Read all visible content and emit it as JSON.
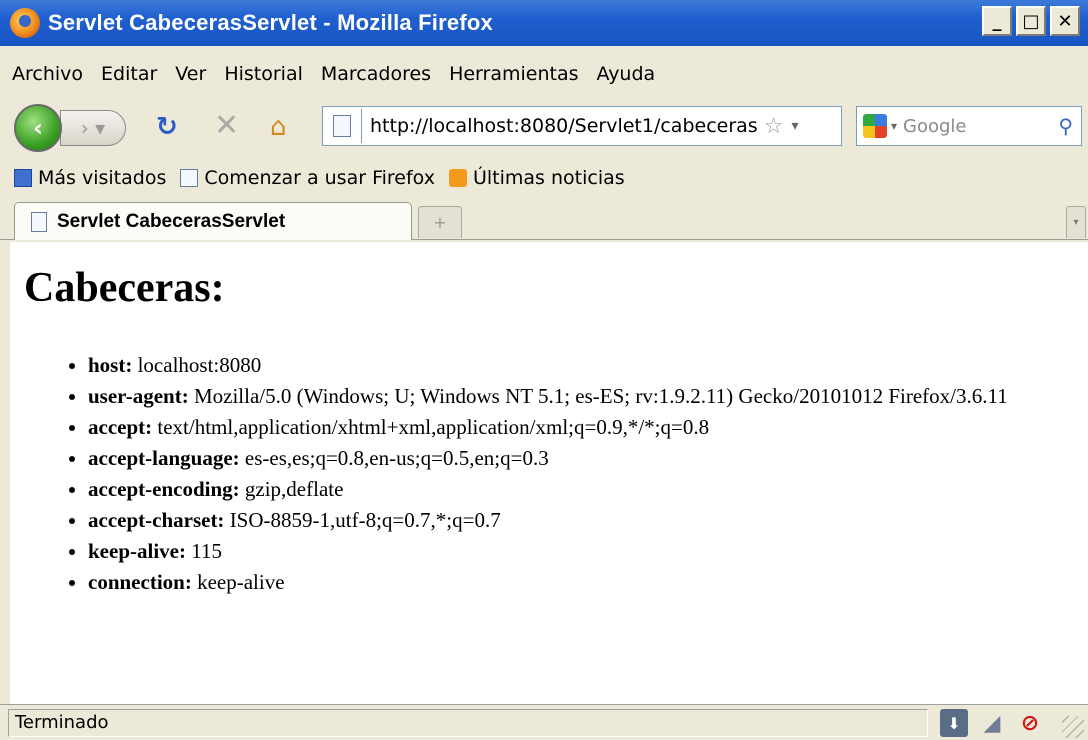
{
  "window": {
    "title": "Servlet CabecerasServlet - Mozilla Firefox",
    "minimize": "_",
    "maximize": "□",
    "close": "✕"
  },
  "menu": [
    "Archivo",
    "Editar",
    "Ver",
    "Historial",
    "Marcadores",
    "Herramientas",
    "Ayuda"
  ],
  "nav": {
    "url": "http://localhost:8080/Servlet1/cabeceras",
    "search_placeholder": "Google"
  },
  "bookmarks": [
    "Más visitados",
    "Comenzar a usar Firefox",
    "Últimas noticias"
  ],
  "tab": {
    "label": "Servlet CabecerasServlet"
  },
  "page": {
    "heading": "Cabeceras:",
    "headers": [
      {
        "name": "host:",
        "value": " localhost:8080"
      },
      {
        "name": "user-agent:",
        "value": " Mozilla/5.0 (Windows; U; Windows NT 5.1; es-ES; rv:1.9.2.11) Gecko/20101012 Firefox/3.6.11"
      },
      {
        "name": "accept:",
        "value": " text/html,application/xhtml+xml,application/xml;q=0.9,*/*;q=0.8"
      },
      {
        "name": "accept-language:",
        "value": " es-es,es;q=0.8,en-us;q=0.5,en;q=0.3"
      },
      {
        "name": "accept-encoding:",
        "value": " gzip,deflate"
      },
      {
        "name": "accept-charset:",
        "value": " ISO-8859-1,utf-8;q=0.7,*;q=0.7"
      },
      {
        "name": "keep-alive:",
        "value": " 115"
      },
      {
        "name": "connection:",
        "value": " keep-alive"
      }
    ]
  },
  "status": {
    "text": "Terminado"
  }
}
